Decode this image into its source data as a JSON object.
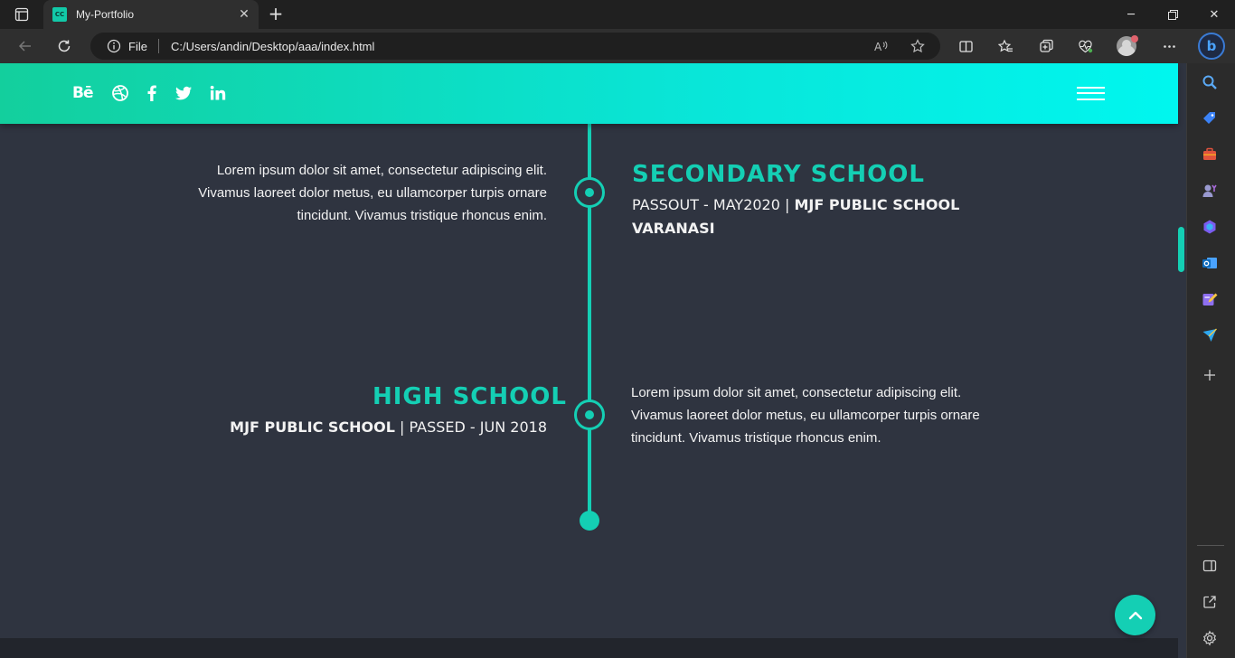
{
  "browser": {
    "tab_title": "My-Portfolio",
    "tab_favicon_text": "CC",
    "address_scheme_label": "File",
    "address_url": "C:/Users/andin/Desktop/aaa/index.html",
    "bing_label": "b"
  },
  "colors": {
    "accent": "#14cfb4",
    "header_gradient_start": "#13cf9d",
    "header_gradient_end": "#00f6ef",
    "page_bg": "#2f3440"
  },
  "header": {
    "social": [
      {
        "name": "behance",
        "label": "Bē"
      },
      {
        "name": "dribbble",
        "icon": "dribbble-icon"
      },
      {
        "name": "facebook",
        "icon": "facebook-icon"
      },
      {
        "name": "twitter",
        "icon": "twitter-icon"
      },
      {
        "name": "linkedin",
        "icon": "linkedin-icon"
      }
    ],
    "menu_icon": "hamburger-icon"
  },
  "timeline": {
    "secondary": {
      "description": "Lorem ipsum dolor sit amet, consectetur adipiscing elit. Vivamus laoreet dolor metus, eu ullamcorper turpis ornare tincidunt. Vivamus tristique rhoncus enim.",
      "title": "SECONDARY SCHOOL",
      "passout": "PASSOUT - MAY2020",
      "separator": "|",
      "school": "MJF PUBLIC SCHOOL VARANASI"
    },
    "high": {
      "title": "HIGH SCHOOL",
      "school": "MJF PUBLIC SCHOOL",
      "separator": "|",
      "passed": "PASSED - JUN 2018",
      "description": "Lorem ipsum dolor sit amet, consectetur adipiscing elit. Vivamus laoreet dolor metus, eu ullamcorper turpis ornare tincidunt. Vivamus tristique rhoncus enim."
    }
  },
  "scroll_top_icon": "chevron-up-icon"
}
